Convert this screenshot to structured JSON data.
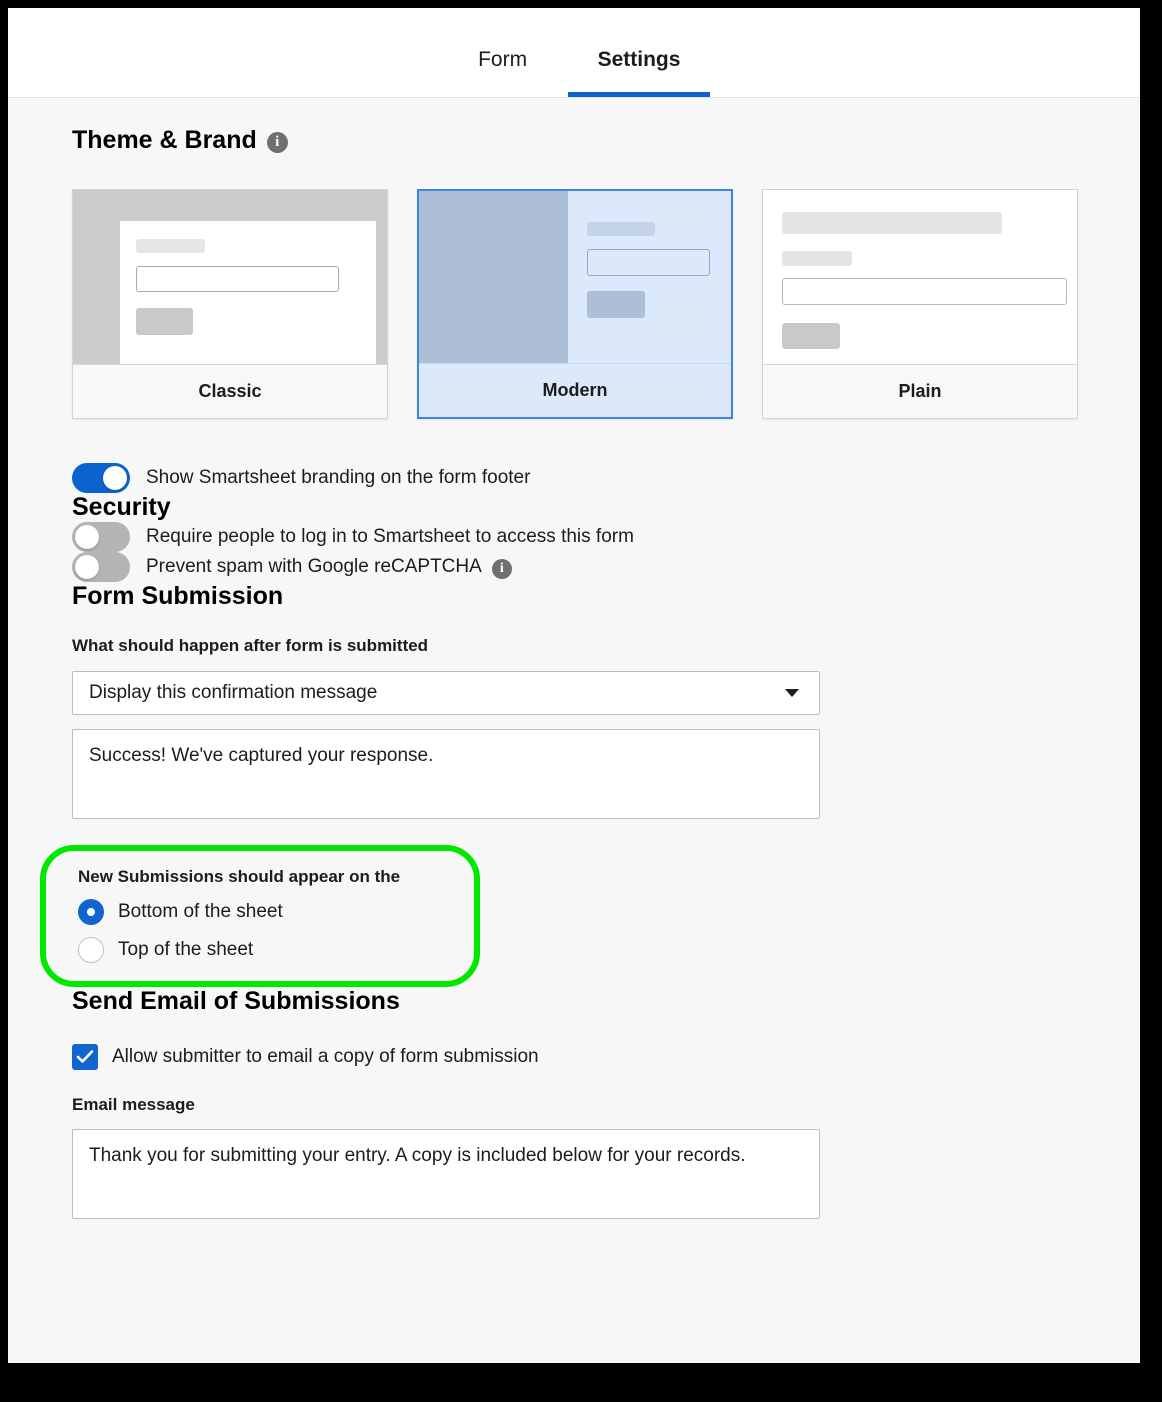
{
  "tabs": [
    {
      "label": "Form",
      "active": false
    },
    {
      "label": "Settings",
      "active": true
    }
  ],
  "theme_section": {
    "title": "Theme & Brand",
    "info_icon": "info-icon",
    "info_glyph": "i",
    "cards": [
      {
        "name": "Classic",
        "selected": false
      },
      {
        "name": "Modern",
        "selected": true
      },
      {
        "name": "Plain",
        "selected": false
      }
    ],
    "branding_toggle": {
      "label": "Show Smartsheet branding on the form footer",
      "state": "on"
    }
  },
  "security_section": {
    "title": "Security",
    "toggles": [
      {
        "label": "Require people to log in to Smartsheet to access this form",
        "state": "off",
        "info": false
      },
      {
        "label": "Prevent spam with Google reCAPTCHA",
        "state": "off",
        "info": true
      }
    ]
  },
  "submission_section": {
    "title": "Form Submission",
    "after_submit_label": "What should happen after form is submitted",
    "after_submit_value": "Display this confirmation message",
    "confirmation_message": "Success! We've captured your response.",
    "new_submissions_label": "New Submissions should appear on the",
    "radios": [
      {
        "label": "Bottom of the sheet",
        "checked": true
      },
      {
        "label": "Top of the sheet",
        "checked": false
      }
    ],
    "highlight_color": "#00e800"
  },
  "email_section": {
    "title": "Send Email of Submissions",
    "allow_checkbox_label": "Allow submitter to email a copy of form submission",
    "allow_checkbox_checked": true,
    "email_message_label": "Email message",
    "email_message_value": "Thank you for submitting your entry. A copy is included below for your records."
  },
  "colors": {
    "accent_blue": "#0b63ce",
    "toggle_off": "#b4b4b4",
    "selected_card_border": "#3b87d8",
    "selected_card_bg": "#dce9fa"
  }
}
